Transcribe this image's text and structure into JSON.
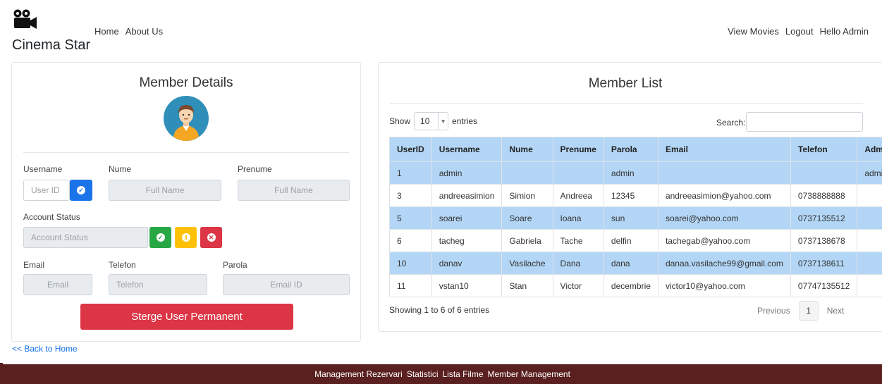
{
  "app": {
    "name": "Cinema Star",
    "logo_icon": "camera-icon"
  },
  "nav": {
    "left": [
      "Home",
      "About Us"
    ],
    "right": [
      "View Movies",
      "Logout",
      "Hello Admin"
    ]
  },
  "member_details": {
    "title": "Member Details",
    "avatar_icon": "user-avatar-icon",
    "labels": {
      "username": "Username",
      "nume": "Nume",
      "prenume": "Prenume",
      "account_status": "Account Status",
      "email": "Email",
      "telefon": "Telefon",
      "parola": "Parola"
    },
    "placeholders": {
      "user_id": "User ID",
      "full_name_1": "Full Name",
      "full_name_2": "Full Name",
      "account_status": "Account Status",
      "email": "Email",
      "telefon": "Telefon",
      "email_id": "Email ID"
    },
    "delete_button": "Sterge User Permanent",
    "colors": {
      "primary": "#1a73e8",
      "success": "#28a745",
      "warning": "#ffc107",
      "danger": "#dc3545"
    }
  },
  "member_list": {
    "title": "Member List",
    "show_label": "Show",
    "entries_value": "10",
    "entries_label": "entries",
    "search_label": "Search:",
    "columns": [
      "UserID",
      "Username",
      "Nume",
      "Prenume",
      "Parola",
      "Email",
      "Telefon",
      "Adm"
    ],
    "rows": [
      [
        "1",
        "admin",
        "",
        "",
        "admin",
        "",
        "",
        "admin"
      ],
      [
        "3",
        "andreeasimion",
        "Simion",
        "Andreea",
        "12345",
        "andreeasimion@yahoo.com",
        "0738888888",
        ""
      ],
      [
        "5",
        "soarei",
        "Soare",
        "Ioana",
        "sun",
        "soarei@yahoo.com",
        "0737135512",
        ""
      ],
      [
        "6",
        "tacheg",
        "Gabriela",
        "Tache",
        "delfin",
        "tachegab@yahoo.com",
        "0737138678",
        ""
      ],
      [
        "10",
        "danav",
        "Vasilache",
        "Dana",
        "dana",
        "danaa.vasilache99@gmail.com",
        "0737138611",
        ""
      ],
      [
        "11",
        "vstan10",
        "Stan",
        "Victor",
        "decembrie",
        "victor10@yahoo.com",
        "07747135512",
        ""
      ]
    ],
    "info": "Showing 1 to 6 of 6 entries",
    "pagination": {
      "previous": "Previous",
      "page": "1",
      "next": "Next"
    }
  },
  "back_link": "<< Back to Home",
  "footer": [
    "Management Rezervari",
    "Statistici",
    "Lista Filme",
    "Member Management"
  ]
}
